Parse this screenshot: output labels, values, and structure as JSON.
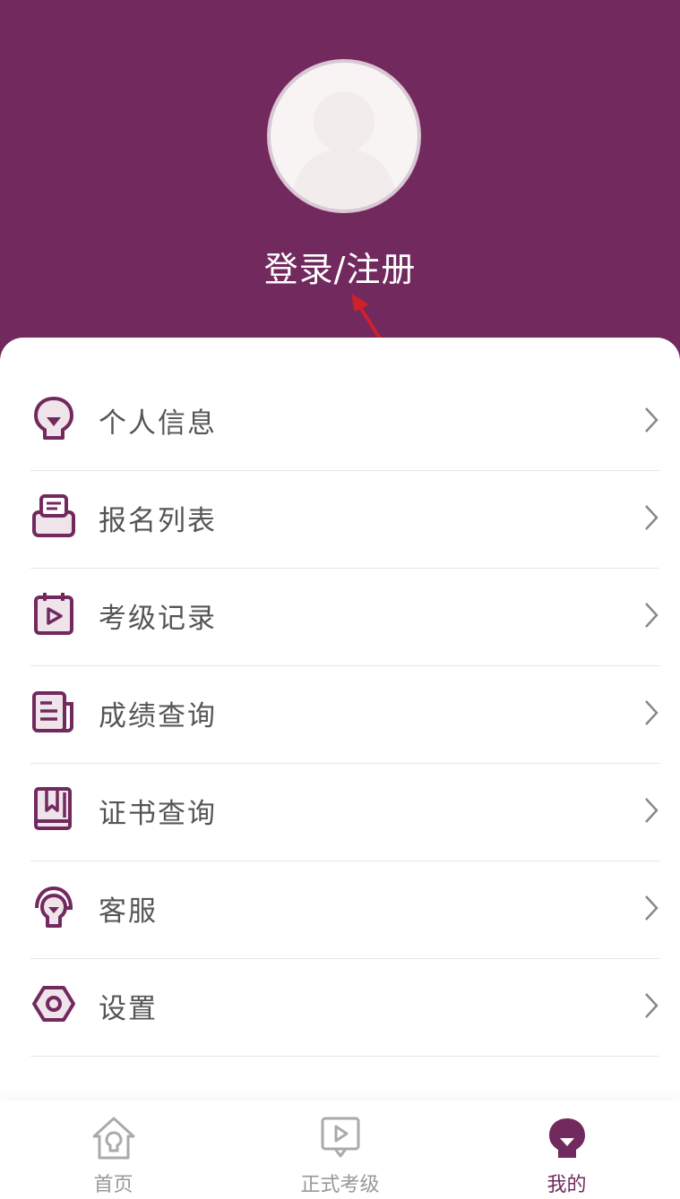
{
  "header": {
    "login_label": "登录/注册",
    "background_color": "#72295e"
  },
  "menu": [
    {
      "icon": "bulb-icon",
      "label": "个人信息"
    },
    {
      "icon": "inbox-icon",
      "label": "报名列表"
    },
    {
      "icon": "calendar-play-icon",
      "label": "考级记录"
    },
    {
      "icon": "report-icon",
      "label": "成绩查询"
    },
    {
      "icon": "book-icon",
      "label": "证书查询"
    },
    {
      "icon": "headset-icon",
      "label": "客服"
    },
    {
      "icon": "gear-icon",
      "label": "设置"
    }
  ],
  "tabbar": {
    "tabs": [
      {
        "icon": "home-icon",
        "label": "首页",
        "active": false
      },
      {
        "icon": "play-board-icon",
        "label": "正式考级",
        "active": false
      },
      {
        "icon": "profile-icon",
        "label": "我的",
        "active": true
      }
    ]
  },
  "colors": {
    "accent": "#72295e",
    "annotation_arrow": "#d0202a"
  }
}
